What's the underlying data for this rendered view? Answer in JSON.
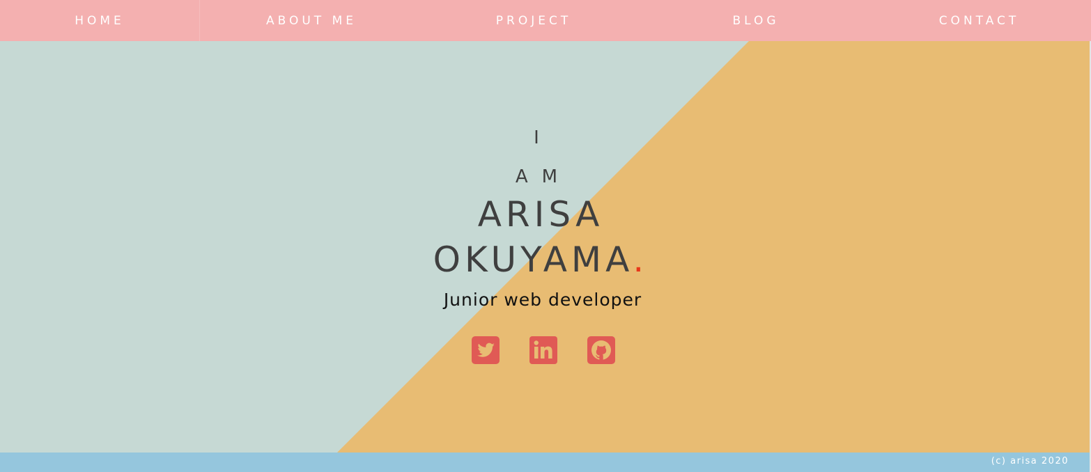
{
  "nav": {
    "items": [
      {
        "label": "HOME"
      },
      {
        "label": "ABOUT ME"
      },
      {
        "label": "PROJECT"
      },
      {
        "label": "BLOG"
      },
      {
        "label": "CONTACT"
      }
    ]
  },
  "hero": {
    "line1": "I",
    "line2": "AM",
    "first_name": "ARISA",
    "last_name": "OKUYAMA",
    "dot": ".",
    "subtitle": "Junior web developer",
    "social": [
      {
        "icon": "twitter-icon"
      },
      {
        "icon": "linkedin-icon"
      },
      {
        "icon": "github-icon"
      }
    ]
  },
  "footer": {
    "copyright": "(c) arisa 2020"
  },
  "colors": {
    "nav_bg": "#f4b0b0",
    "hero_left": "#c6d9d4",
    "hero_right": "#e8bc73",
    "accent": "#e8371b",
    "icon": "#e05a55",
    "footer_bg": "#95c6dd"
  }
}
